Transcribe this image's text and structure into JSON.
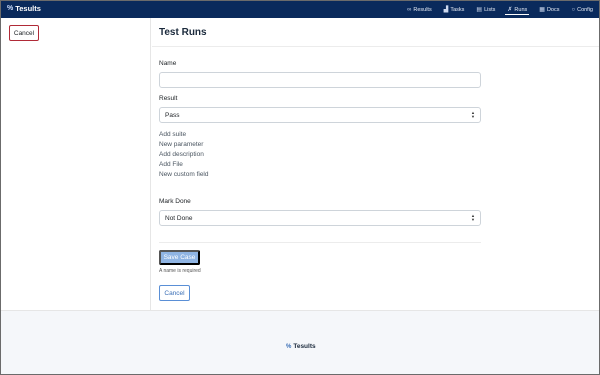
{
  "app": {
    "brand_symbol": "%",
    "brand_name": "Tesults"
  },
  "nav": {
    "items": [
      {
        "label": "Results",
        "icon": "infinity-icon",
        "glyph": "∞",
        "active": false
      },
      {
        "label": "Tasks",
        "icon": "bar-chart-icon",
        "glyph": "▟",
        "active": false
      },
      {
        "label": "Lists",
        "icon": "document-icon",
        "glyph": "▤",
        "active": false
      },
      {
        "label": "Runs",
        "icon": "runner-icon",
        "glyph": "✗",
        "active": true
      },
      {
        "label": "Docs",
        "icon": "docs-icon",
        "glyph": "▦",
        "active": false
      },
      {
        "label": "Config",
        "icon": "gear-icon",
        "glyph": "○",
        "active": false
      }
    ]
  },
  "sidebar": {
    "cancel_label": "Cancel"
  },
  "main": {
    "title": "Test Runs",
    "name_label": "Name",
    "name_value": "",
    "result_label": "Result",
    "result_value": "Pass",
    "links": [
      "Add suite",
      "New parameter",
      "Add description",
      "Add File",
      "New custom field"
    ],
    "mark_done_label": "Mark Done",
    "mark_done_value": "Not Done",
    "save_label": "Save Case",
    "save_hint": "A name is required",
    "cancel_label": "Cancel"
  },
  "footer": {
    "brand_symbol": "%",
    "brand_name": "Tesults"
  },
  "colors": {
    "navbar": "#0a2a5c",
    "primary_disabled": "#8fb4e3",
    "cancel_border": "#b02a37",
    "footer_bg": "#f5f7fa"
  }
}
